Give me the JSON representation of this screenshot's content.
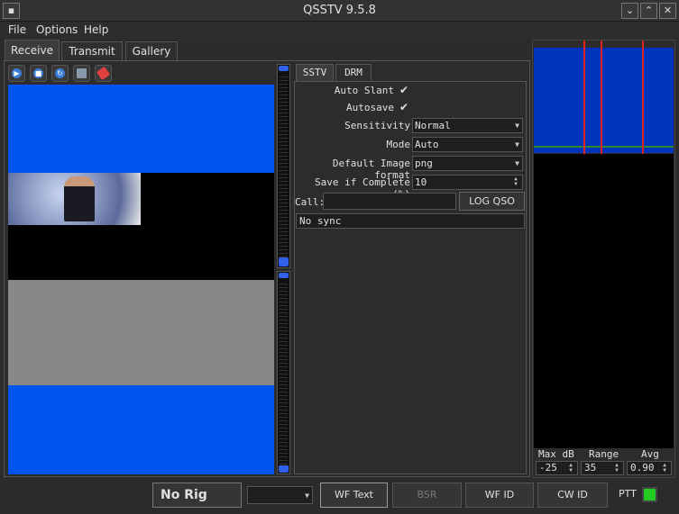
{
  "window": {
    "title": "QSSTV 9.5.8",
    "sys_menu": "▪",
    "min": "⌄",
    "max": "⌃",
    "close": "✕"
  },
  "menu": [
    "File",
    "Options",
    "Help"
  ],
  "tabs": [
    "Receive",
    "Transmit",
    "Gallery"
  ],
  "toolbar_icons": [
    "play-icon",
    "stop-icon",
    "refresh-icon",
    "save-icon",
    "erase-icon"
  ],
  "sstv": {
    "tabs": [
      "SSTV",
      "DRM"
    ],
    "auto_slant_label": "Auto Slant",
    "auto_slant_checked": "✔",
    "autosave_label": "Autosave",
    "autosave_checked": "✔",
    "sensitivity_label": "Sensitivity",
    "sensitivity_value": "Normal",
    "mode_label": "Mode",
    "mode_value": "Auto",
    "image_format_label": "Default Image format",
    "image_format_value": "png",
    "save_complete_label": "Save if Complete (%)",
    "save_complete_value": "10",
    "call_label": "Call:",
    "call_value": "",
    "log_qso_label": "LOG QSO",
    "status_text": "No sync"
  },
  "waterfall": {
    "max_db_label": "Max dB",
    "range_label": "Range",
    "avg_label": "Avg",
    "max_db_value": "-25",
    "range_value": "35",
    "avg_value": "0.90"
  },
  "bottom": {
    "rig_label": "No Rig",
    "wf_text_label": "WF Text",
    "bsr_label": "BSR",
    "wf_id_label": "WF ID",
    "cw_id_label": "CW ID",
    "ptt_label": "PTT"
  },
  "colors": {
    "image_blue": "#0055ee",
    "image_gray": "#888888",
    "ptt_on": "#22cc22",
    "wf_marker": "#dd2222"
  }
}
